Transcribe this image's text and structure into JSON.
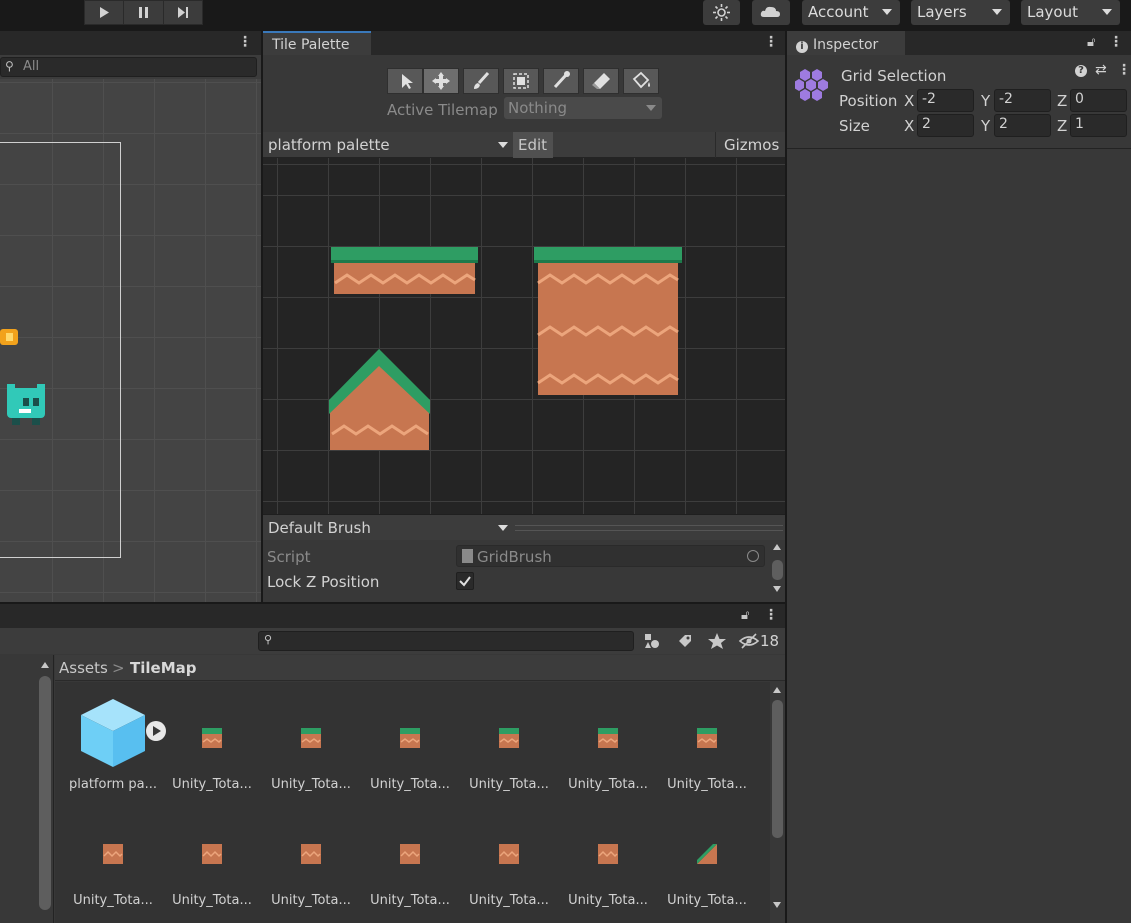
{
  "toolbar": {
    "account_label": "Account",
    "layers_label": "Layers",
    "layout_label": "Layout"
  },
  "scene": {
    "search_placeholder": "All"
  },
  "tile_palette": {
    "tab_label": "Tile Palette",
    "active_tilemap_label": "Active Tilemap",
    "active_tilemap_value": "Nothing",
    "palette_name": "platform palette",
    "edit_label": "Edit",
    "gizmos_label": "Gizmos",
    "brush_name": "Default Brush",
    "script_label": "Script",
    "script_value": "GridBrush",
    "lock_z_label": "Lock Z Position",
    "lock_z_checked": true
  },
  "inspector": {
    "tab_label": "Inspector",
    "title": "Grid Selection",
    "position_label": "Position",
    "size_label": "Size",
    "position": {
      "x_label": "X",
      "x": "-2",
      "y_label": "Y",
      "y": "-2",
      "z_label": "Z",
      "z": "0"
    },
    "size": {
      "x_label": "X",
      "x": "2",
      "y_label": "Y",
      "y": "2",
      "z_label": "Z",
      "z": "1"
    }
  },
  "project": {
    "hidden_count": "18",
    "breadcrumb_root": "Assets",
    "breadcrumb_sep": ">",
    "breadcrumb_current": "TileMap",
    "row1": [
      "platform pa...",
      "Unity_Tota...",
      "Unity_Tota...",
      "Unity_Tota...",
      "Unity_Tota...",
      "Unity_Tota...",
      "Unity_Tota..."
    ],
    "row2": [
      "Unity_Tota...",
      "Unity_Tota...",
      "Unity_Tota...",
      "Unity_Tota...",
      "Unity_Tota...",
      "Unity_Tota...",
      "Unity_Tota..."
    ]
  },
  "colors": {
    "grass": "#2e9d63",
    "dirt": "#c77650",
    "accent": "#3a79bb"
  }
}
